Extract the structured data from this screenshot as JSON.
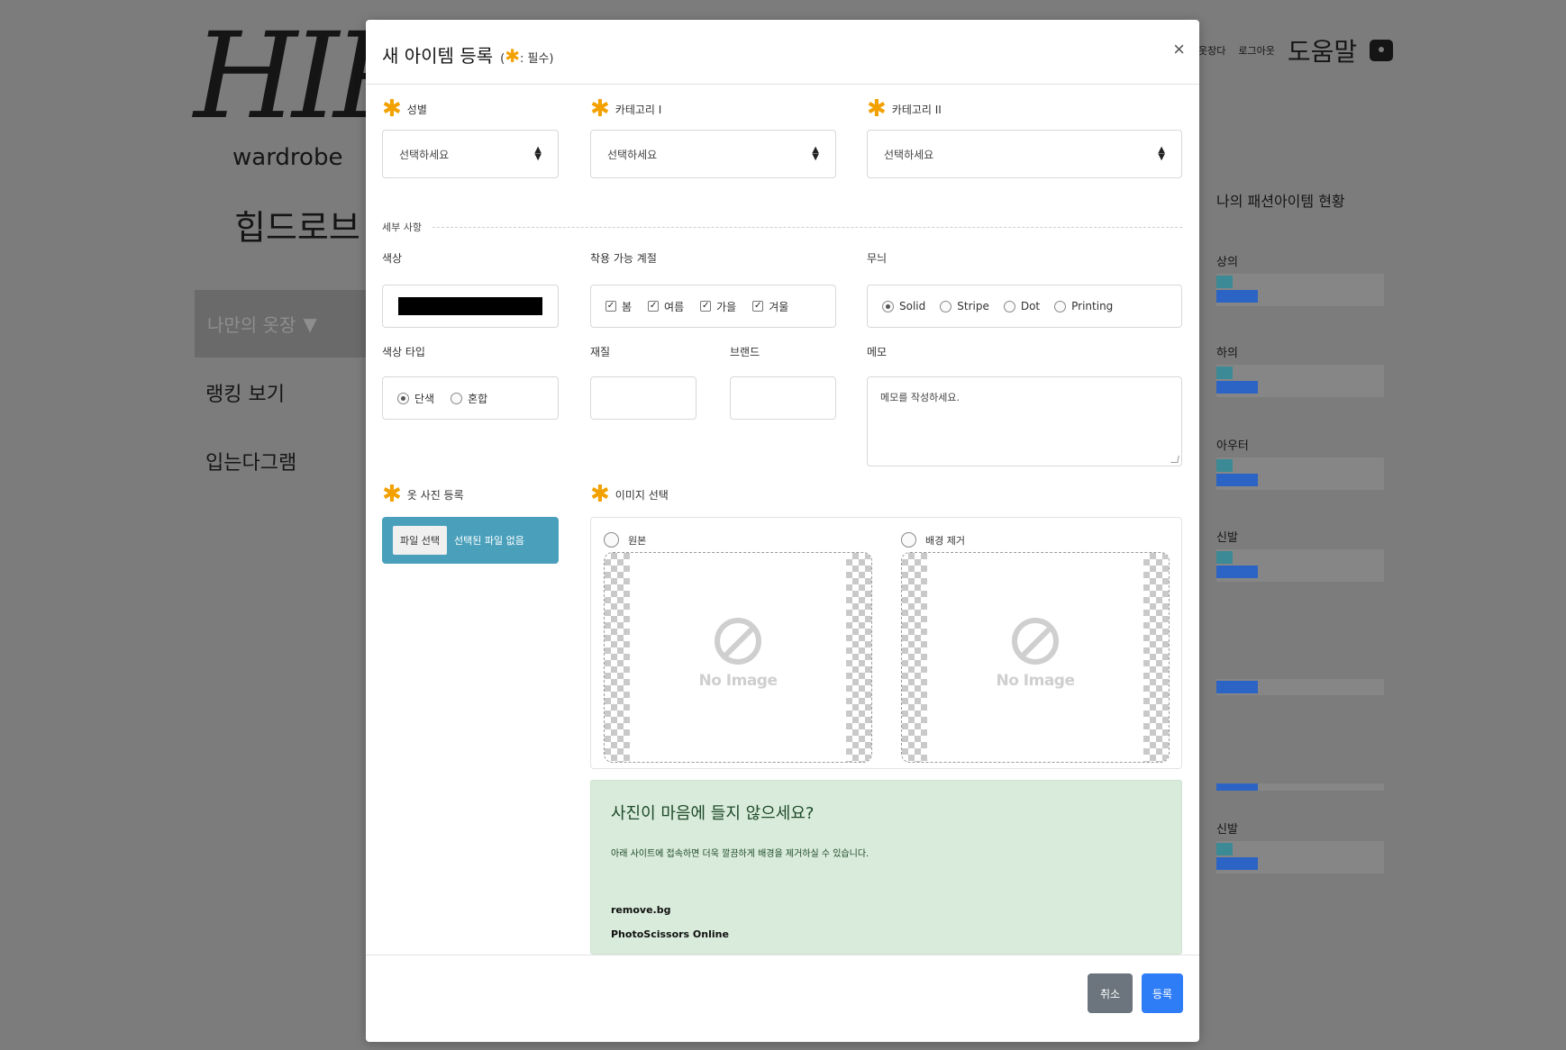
{
  "background": {
    "logo": "HIP",
    "wardrobe": "wardrobe",
    "brand_kr": "힙드로브",
    "sidebar": {
      "active": "나만의 옷장",
      "items": [
        "랭킹 보기",
        "입는다그램"
      ]
    },
    "top_nav": {
      "link1": "옷장다",
      "link2": "로그아웃",
      "help": "도움말"
    },
    "stats": {
      "title": "나의 패션아이템 현황",
      "rows": [
        {
          "cat": "상의"
        },
        {
          "cat": "하의"
        },
        {
          "cat": "아우터"
        },
        {
          "cat": "신발"
        },
        {
          "cat": ""
        },
        {
          "cat": ""
        },
        {
          "cat": "신발"
        }
      ]
    }
  },
  "modal": {
    "title": "새 아이템 등록",
    "required_hint_prefix": "(",
    "required_hint_suffix": ": 필수)",
    "close": "×",
    "fields": {
      "gender_label": "성별",
      "gender_value": "선택하세요",
      "cat1_label": "카테고리 I",
      "cat1_value": "선택하세요",
      "cat2_label": "카테고리 II",
      "cat2_value": "선택하세요",
      "detail_section": "세부 사항",
      "color_label": "색상",
      "color_value": "#000000",
      "season_label": "착용 가능 계절",
      "seasons": [
        "봄",
        "여름",
        "가을",
        "겨울"
      ],
      "pattern_label": "무늬",
      "patterns": [
        "Solid",
        "Stripe",
        "Dot",
        "Printing"
      ],
      "color_type_label": "색상 타입",
      "color_types": [
        "단색",
        "혼합"
      ],
      "material_label": "재질",
      "brand_label": "브랜드",
      "memo_label": "메모",
      "memo_placeholder": "메모를 작성하세요.",
      "photo_label": "옷 사진 등록",
      "file_pick": "파일 선택",
      "file_none": "선택된 파일 없음",
      "image_select_label": "이미지 선택",
      "image_original": "원본",
      "image_bg_removed": "배경 제거",
      "no_image": "No Image"
    },
    "tip": {
      "heading": "사진이 마음에 들지 않으세요?",
      "body": "아래 사이트에 접속하면 더욱 깔끔하게 배경을 제거하실 수 있습니다.",
      "links": [
        "remove.bg",
        "PhotoScissors Online"
      ]
    },
    "footer": {
      "cancel": "취소",
      "save": "등록"
    }
  },
  "colors": {
    "required_star": "#f2a100",
    "file_button": "#4aa0bb",
    "save_button": "#2e7cf6",
    "cancel_button": "#6c757d",
    "tip_bg": "#d9ebda"
  }
}
